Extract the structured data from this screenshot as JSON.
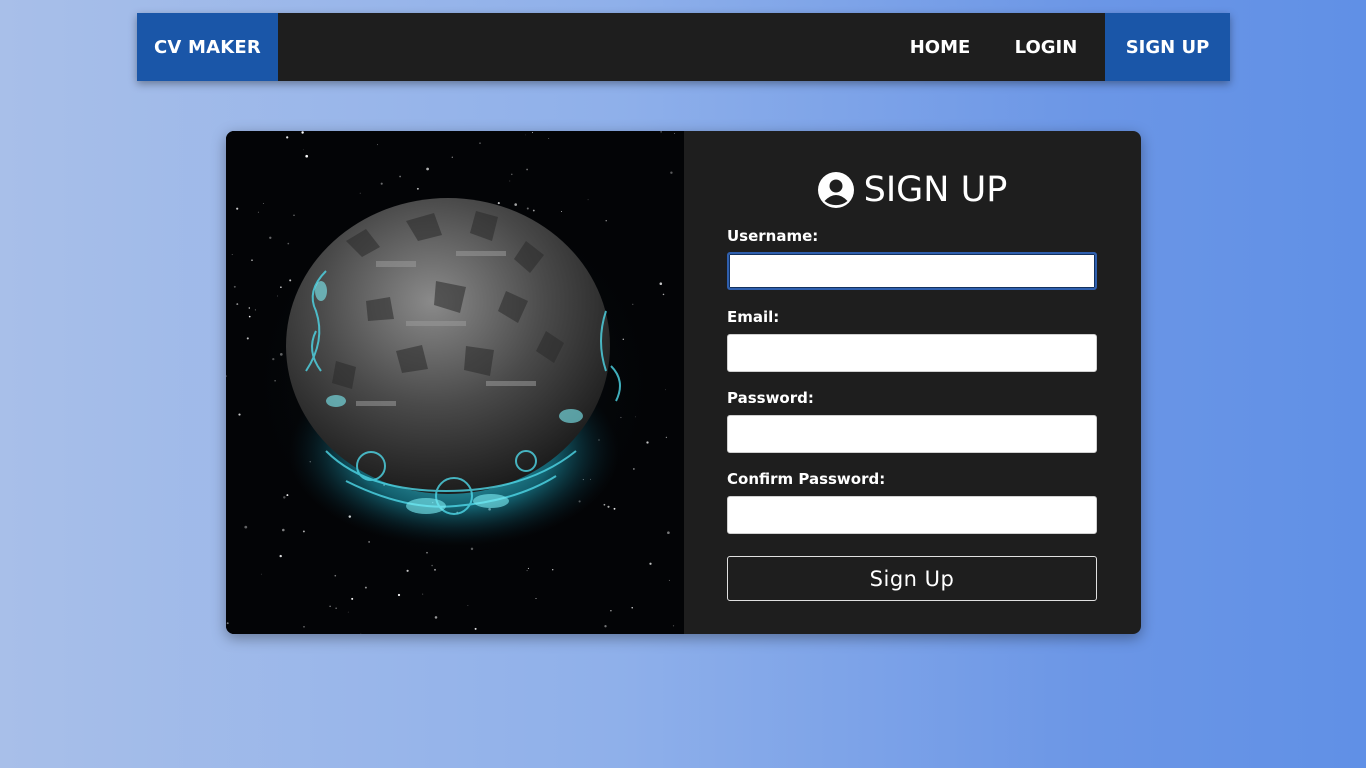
{
  "navbar": {
    "brand": "CV MAKER",
    "links": [
      {
        "label": "HOME"
      },
      {
        "label": "LOGIN"
      },
      {
        "label": "SIGN UP",
        "active": true
      }
    ],
    "brand_color": "#1a56a8",
    "bar_color": "#1e1e1e"
  },
  "hero_image": {
    "description_icon": "planet-illustration"
  },
  "form": {
    "title": "SIGN UP",
    "title_icon": "user-circle-icon",
    "fields": [
      {
        "label": "Username:",
        "value": "",
        "placeholder": "",
        "focused": true
      },
      {
        "label": "Email:",
        "value": "",
        "placeholder": ""
      },
      {
        "label": "Password:",
        "value": "",
        "placeholder": ""
      },
      {
        "label": "Confirm Password:",
        "value": "",
        "placeholder": ""
      }
    ],
    "submit_label": "Sign Up"
  }
}
